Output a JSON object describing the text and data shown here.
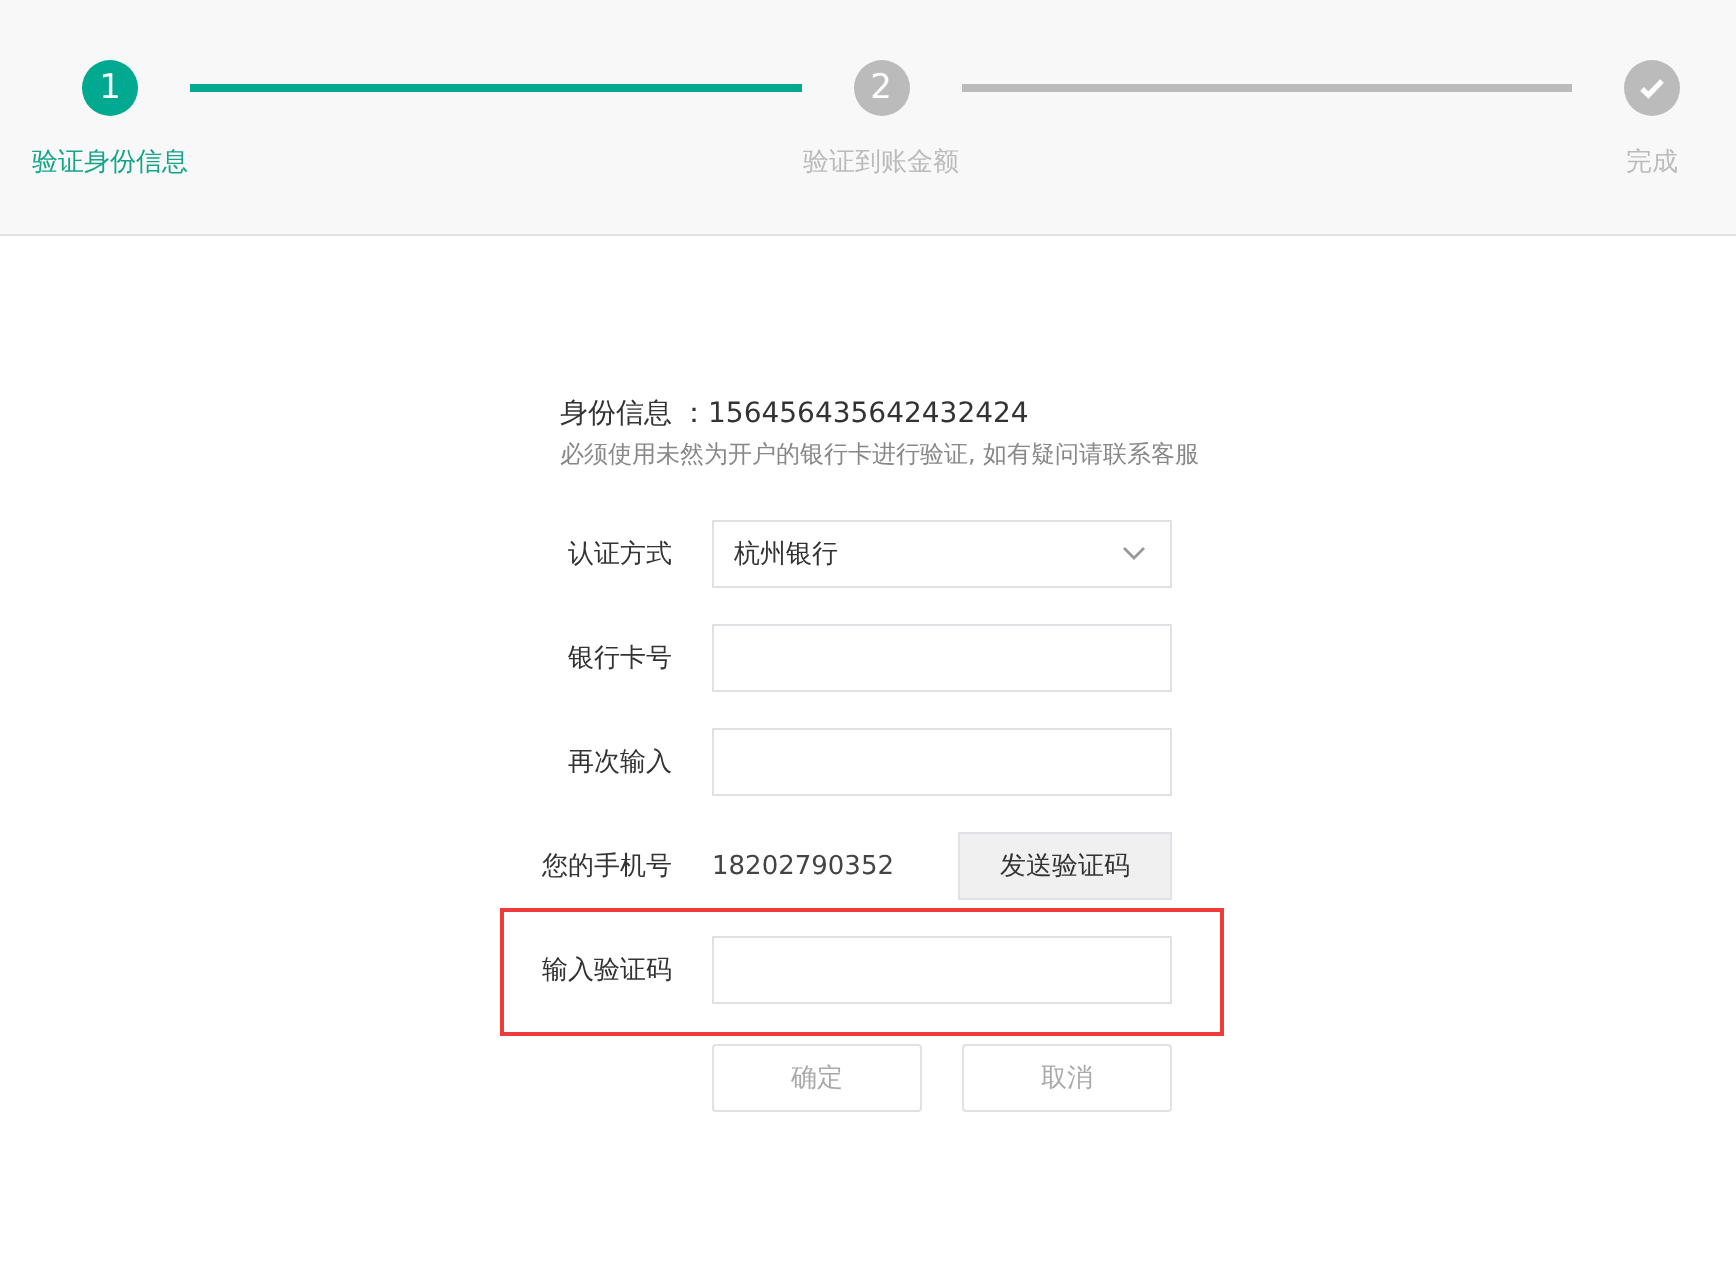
{
  "steps": [
    {
      "kind": "number",
      "marker": "1",
      "label": "验证身份信息",
      "active": true
    },
    {
      "kind": "number",
      "marker": "2",
      "label": "验证到账金额",
      "active": false
    },
    {
      "kind": "check",
      "label": "完成",
      "active": false
    }
  ],
  "identity": {
    "label": "身份信息",
    "value": "：156456435642432424",
    "note": "必须使用未然为开户的银行卡进行验证, 如有疑问请联系客服"
  },
  "fields": [
    {
      "kind": "select",
      "label": "认证方式",
      "value": "杭州银行",
      "highlighted": false
    },
    {
      "kind": "input",
      "label": "银行卡号",
      "highlighted": false
    },
    {
      "kind": "input",
      "label": "再次输入",
      "highlighted": false
    },
    {
      "kind": "phone",
      "label": "您的手机号",
      "value": "18202790352",
      "button": "发送验证码",
      "highlighted": false
    },
    {
      "kind": "input",
      "label": "输入验证码",
      "highlighted": true
    }
  ],
  "buttons": [
    {
      "label": "确定"
    },
    {
      "label": "取消"
    }
  ]
}
